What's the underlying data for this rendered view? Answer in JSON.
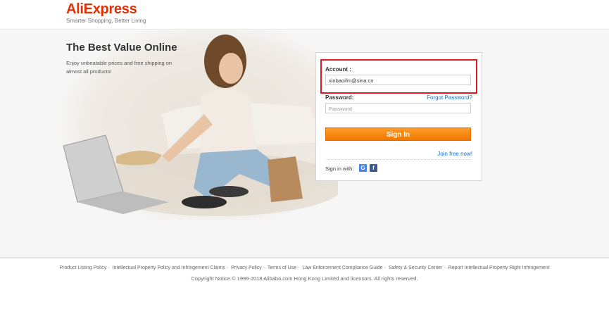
{
  "header": {
    "logo": "AliExpress",
    "tagline": "Smarter Shopping, Better Living"
  },
  "hero": {
    "title": "The Best Value Online",
    "description": "Enjoy unbeatable prices and free shipping on almost all products!"
  },
  "login": {
    "account_label": "Account :",
    "account_value": "xinbaoifm@sina.cn",
    "password_label": "Password:",
    "password_placeholder": "Password",
    "forgot_link": "Forgot Password?",
    "signin_button": "Sign In",
    "join_link": "Join free now!",
    "signin_with_label": "Sign in with:",
    "social": [
      {
        "name": "google",
        "glyph": "G",
        "color": "#4a84e8"
      },
      {
        "name": "facebook",
        "glyph": "f",
        "color": "#3b5998"
      }
    ]
  },
  "footer": {
    "links": [
      "Product Listing Policy",
      "Intellectual Property Policy and Infringement Claims",
      "Privacy Policy",
      "Terms of Use",
      "Law Enforcement Compliance Guide",
      "Safety & Security Center",
      "Report Intellectual Property Right Infringement"
    ],
    "copyright": "Copyright Notice © 1999-2018 Alibaba.com Hong Kong Limited and licensors. All rights reserved."
  },
  "colors": {
    "brand": "#e62e04",
    "signin": "#f58a00",
    "highlight": "#e01b22",
    "link": "#1a73c8"
  }
}
